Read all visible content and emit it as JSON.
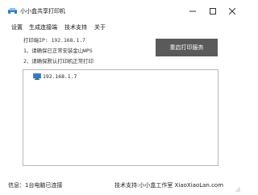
{
  "window": {
    "title": "小小盒共享打印机",
    "icons": {
      "app": "printer-app-icon",
      "minimize": "minimize-icon",
      "maximize": "maximize-icon",
      "close": "close-icon"
    }
  },
  "menu": {
    "items": [
      {
        "label": "设置"
      },
      {
        "label": "生成连接端"
      },
      {
        "label": "技术支持"
      },
      {
        "label": "关于"
      }
    ]
  },
  "info": {
    "lines": [
      "打印端IP: 192.168.1.7",
      "1、请确保已正常安装金山WPS",
      "2、请确保默认打印机正常打印"
    ]
  },
  "actions": {
    "restart_label": "重启打印服务"
  },
  "tree": {
    "items": [
      {
        "label": "192.168.1.7",
        "icon": "computer-icon"
      }
    ]
  },
  "status": {
    "left_label": "信息：",
    "left_value": "1台电脑已连接",
    "right_label": "技术支持:小小盒工作室",
    "right_site": "XiaoXiaoLan.com"
  },
  "colors": {
    "accent_button": "#5a5a5a",
    "icon_blue": "#2a7fd4"
  }
}
